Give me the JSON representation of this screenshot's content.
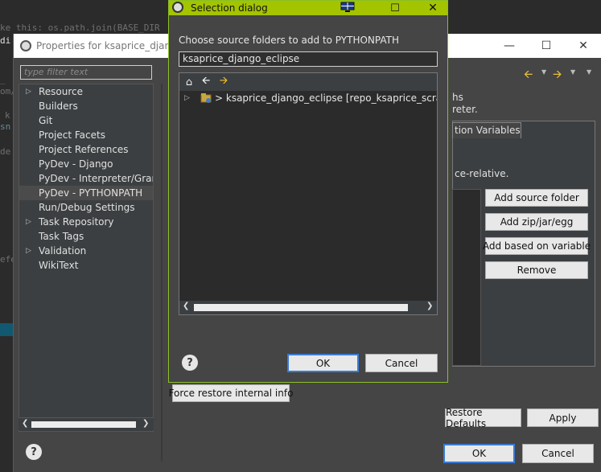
{
  "editor": {
    "lines": [
      "ke this: os.path.join(BASE_DIR",
      "di",
      "_",
      "om/",
      "k",
      "sn",
      "de",
      "efe"
    ]
  },
  "properties_dialog": {
    "title": "Properties for ksaprice_django_",
    "filter_placeholder": "type filter text",
    "tree_items": [
      {
        "label": "Resource",
        "expandable": true
      },
      {
        "label": "Builders",
        "expandable": false
      },
      {
        "label": "Git",
        "expandable": false
      },
      {
        "label": "Project Facets",
        "expandable": false
      },
      {
        "label": "Project References",
        "expandable": false
      },
      {
        "label": "PyDev - Django",
        "expandable": false
      },
      {
        "label": "PyDev - Interpreter/Grammar",
        "expandable": false
      },
      {
        "label": "PyDev - PYTHONPATH",
        "expandable": false,
        "selected": true
      },
      {
        "label": "Run/Debug Settings",
        "expandable": false
      },
      {
        "label": "Task Repository",
        "expandable": true
      },
      {
        "label": "Task Tags",
        "expandable": false
      },
      {
        "label": "Validation",
        "expandable": true
      },
      {
        "label": "WikiText",
        "expandable": false
      }
    ],
    "right_text_line1": "hs",
    "right_text_line2": "reter.",
    "tab_label": "tion Variables",
    "tab_text": "ce-relative.",
    "side_buttons": {
      "add_source_folder": "Add source folder",
      "add_zip": "Add zip/jar/egg",
      "add_based_on_variable": "Add based on variable",
      "remove": "Remove"
    },
    "force_restore": "Force restore internal info",
    "restore_defaults": "Restore Defaults",
    "apply": "Apply",
    "ok": "OK",
    "cancel": "Cancel",
    "help": "?"
  },
  "selection_dialog": {
    "title": "Selection dialog",
    "prompt": "Choose source folders to add to PYTHONPATH",
    "filter_value": "ksaprice_django_eclipse",
    "tree_row": "> ksaprice_django_eclipse [repo_ksaprice_scrapy_dja",
    "ok": "OK",
    "cancel": "Cancel",
    "help": "?"
  },
  "colors": {
    "selection_title_bg": "#a4c400",
    "dialog_bg": "#454545",
    "nav_arrow": "#e8c03a",
    "focus_border": "#3a7bd5"
  }
}
